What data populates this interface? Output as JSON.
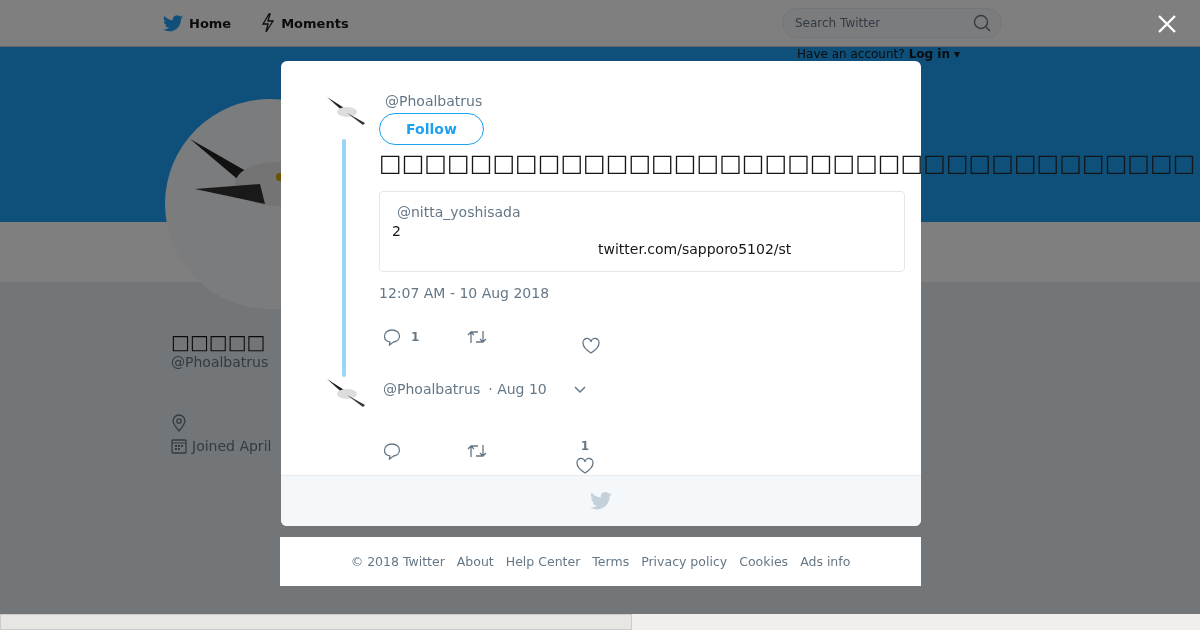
{
  "nav": {
    "items": [
      {
        "label": "Home"
      },
      {
        "label": "Moments"
      }
    ],
    "search": {
      "placeholder": "Search Twitter"
    },
    "login_prompt": "Have an account?",
    "login_link": "Log in ▾"
  },
  "profile": {
    "name": "□□□□□",
    "handle": "@Phoalbatrus",
    "joined": "Joined April"
  },
  "modal": {
    "tweet": {
      "handle": "@Phoalbatrus",
      "follow": "Follow",
      "text": "□□□□□□□□□□□□□□□□□□□□□□□□□□□□□□□□□□□□",
      "quote": {
        "handle": "@nitta_yoshisada",
        "text": "2",
        "link": "twitter.com/sapporo5102/st"
      },
      "timestamp": "12:07 AM - 10 Aug 2018",
      "replies": "1"
    },
    "reply": {
      "handle": "@Phoalbatrus",
      "date": "· Aug 10",
      "likes": "1"
    }
  },
  "footer": [
    "© 2018 Twitter",
    "About",
    "Help Center",
    "Terms",
    "Privacy policy",
    "Cookies",
    "Ads info"
  ]
}
